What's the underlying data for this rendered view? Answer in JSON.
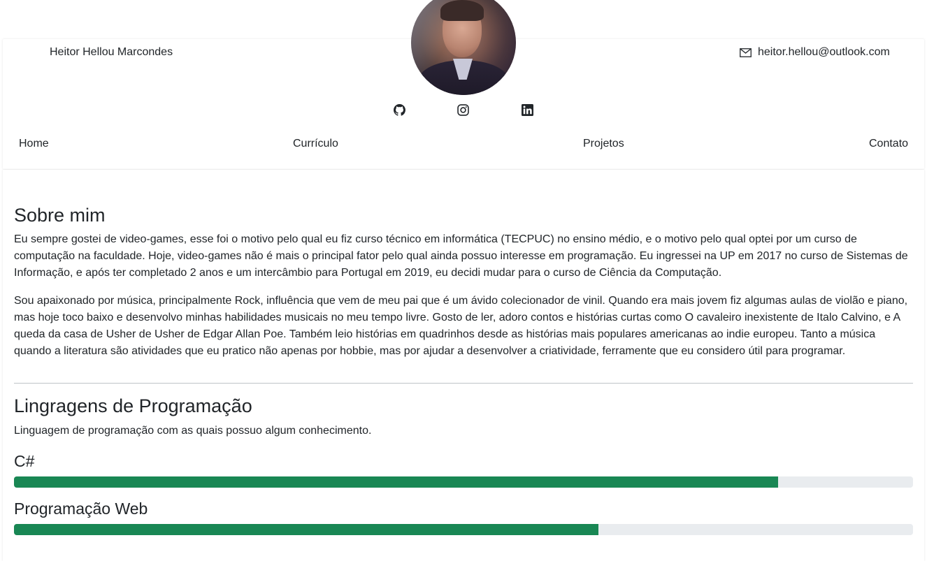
{
  "header": {
    "name": "Heitor Hellou Marcondes",
    "email": "heitor.hellou@outlook.com"
  },
  "social": [
    "github-icon",
    "instagram-icon",
    "linkedin-icon"
  ],
  "nav": {
    "home": "Home",
    "curriculo": "Currículo",
    "projetos": "Projetos",
    "contato": "Contato"
  },
  "about": {
    "title": "Sobre mim",
    "paragraph1": "Eu sempre gostei de video-games, esse foi o motivo pelo qual eu fiz curso técnico em informática (TECPUC) no ensino médio, e o motivo pelo qual optei por um curso de computação na faculdade. Hoje, video-games não é mais o principal fator pelo qual ainda possuo interesse em programação. Eu ingressei na UP em 2017 no curso de Sistemas de Informação, e após ter completado 2 anos e um intercâmbio para Portugal em 2019, eu decidi mudar para o curso de Ciência da Computação.",
    "paragraph2": "Sou apaixonado por música, principalmente Rock, influência que vem de meu pai que é um ávido colecionador de vinil. Quando era mais jovem fiz algumas aulas de violão e piano, mas hoje toco baixo e desenvolvo minhas habilidades musicais no meu tempo livre. Gosto de ler, adoro contos e histórias curtas como O cavaleiro inexistente de Italo Calvino, e A queda da casa de Usher de Usher de Edgar Allan Poe. Também leio histórias em quadrinhos desde as histórias mais populares americanas ao indie europeu. Tanto a música quando a literatura são atividades que eu pratico não apenas por hobbie, mas por ajudar a desenvolver a criatividade, ferramente que eu considero útil para programar."
  },
  "languages": {
    "title": "Lingragens de Programação",
    "description": "Linguagem de programação com as quais possuo algum conhecimento.",
    "skills": [
      {
        "name": "C#",
        "level": 0.85
      },
      {
        "name": "Programação Web",
        "level": 0.65
      }
    ]
  },
  "colors": {
    "progress": "#198754",
    "track": "#e9ecef"
  }
}
